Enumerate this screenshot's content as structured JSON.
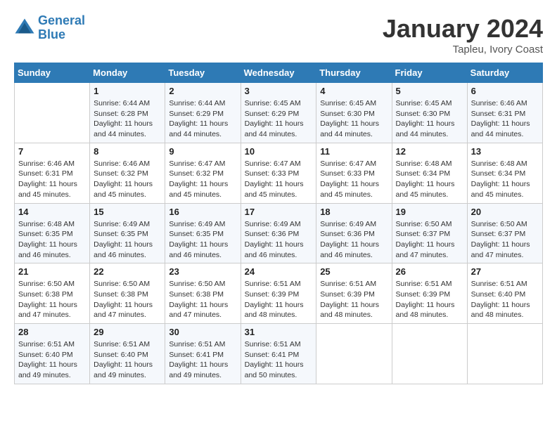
{
  "header": {
    "logo_line1": "General",
    "logo_line2": "Blue",
    "month": "January 2024",
    "location": "Tapleu, Ivory Coast"
  },
  "days_of_week": [
    "Sunday",
    "Monday",
    "Tuesday",
    "Wednesday",
    "Thursday",
    "Friday",
    "Saturday"
  ],
  "weeks": [
    [
      {
        "day": "",
        "info": ""
      },
      {
        "day": "1",
        "info": "Sunrise: 6:44 AM\nSunset: 6:28 PM\nDaylight: 11 hours and 44 minutes."
      },
      {
        "day": "2",
        "info": "Sunrise: 6:44 AM\nSunset: 6:29 PM\nDaylight: 11 hours and 44 minutes."
      },
      {
        "day": "3",
        "info": "Sunrise: 6:45 AM\nSunset: 6:29 PM\nDaylight: 11 hours and 44 minutes."
      },
      {
        "day": "4",
        "info": "Sunrise: 6:45 AM\nSunset: 6:30 PM\nDaylight: 11 hours and 44 minutes."
      },
      {
        "day": "5",
        "info": "Sunrise: 6:45 AM\nSunset: 6:30 PM\nDaylight: 11 hours and 44 minutes."
      },
      {
        "day": "6",
        "info": "Sunrise: 6:46 AM\nSunset: 6:31 PM\nDaylight: 11 hours and 44 minutes."
      }
    ],
    [
      {
        "day": "7",
        "info": "Sunrise: 6:46 AM\nSunset: 6:31 PM\nDaylight: 11 hours and 45 minutes."
      },
      {
        "day": "8",
        "info": "Sunrise: 6:46 AM\nSunset: 6:32 PM\nDaylight: 11 hours and 45 minutes."
      },
      {
        "day": "9",
        "info": "Sunrise: 6:47 AM\nSunset: 6:32 PM\nDaylight: 11 hours and 45 minutes."
      },
      {
        "day": "10",
        "info": "Sunrise: 6:47 AM\nSunset: 6:33 PM\nDaylight: 11 hours and 45 minutes."
      },
      {
        "day": "11",
        "info": "Sunrise: 6:47 AM\nSunset: 6:33 PM\nDaylight: 11 hours and 45 minutes."
      },
      {
        "day": "12",
        "info": "Sunrise: 6:48 AM\nSunset: 6:34 PM\nDaylight: 11 hours and 45 minutes."
      },
      {
        "day": "13",
        "info": "Sunrise: 6:48 AM\nSunset: 6:34 PM\nDaylight: 11 hours and 45 minutes."
      }
    ],
    [
      {
        "day": "14",
        "info": "Sunrise: 6:48 AM\nSunset: 6:35 PM\nDaylight: 11 hours and 46 minutes."
      },
      {
        "day": "15",
        "info": "Sunrise: 6:49 AM\nSunset: 6:35 PM\nDaylight: 11 hours and 46 minutes."
      },
      {
        "day": "16",
        "info": "Sunrise: 6:49 AM\nSunset: 6:35 PM\nDaylight: 11 hours and 46 minutes."
      },
      {
        "day": "17",
        "info": "Sunrise: 6:49 AM\nSunset: 6:36 PM\nDaylight: 11 hours and 46 minutes."
      },
      {
        "day": "18",
        "info": "Sunrise: 6:49 AM\nSunset: 6:36 PM\nDaylight: 11 hours and 46 minutes."
      },
      {
        "day": "19",
        "info": "Sunrise: 6:50 AM\nSunset: 6:37 PM\nDaylight: 11 hours and 47 minutes."
      },
      {
        "day": "20",
        "info": "Sunrise: 6:50 AM\nSunset: 6:37 PM\nDaylight: 11 hours and 47 minutes."
      }
    ],
    [
      {
        "day": "21",
        "info": "Sunrise: 6:50 AM\nSunset: 6:38 PM\nDaylight: 11 hours and 47 minutes."
      },
      {
        "day": "22",
        "info": "Sunrise: 6:50 AM\nSunset: 6:38 PM\nDaylight: 11 hours and 47 minutes."
      },
      {
        "day": "23",
        "info": "Sunrise: 6:50 AM\nSunset: 6:38 PM\nDaylight: 11 hours and 47 minutes."
      },
      {
        "day": "24",
        "info": "Sunrise: 6:51 AM\nSunset: 6:39 PM\nDaylight: 11 hours and 48 minutes."
      },
      {
        "day": "25",
        "info": "Sunrise: 6:51 AM\nSunset: 6:39 PM\nDaylight: 11 hours and 48 minutes."
      },
      {
        "day": "26",
        "info": "Sunrise: 6:51 AM\nSunset: 6:39 PM\nDaylight: 11 hours and 48 minutes."
      },
      {
        "day": "27",
        "info": "Sunrise: 6:51 AM\nSunset: 6:40 PM\nDaylight: 11 hours and 48 minutes."
      }
    ],
    [
      {
        "day": "28",
        "info": "Sunrise: 6:51 AM\nSunset: 6:40 PM\nDaylight: 11 hours and 49 minutes."
      },
      {
        "day": "29",
        "info": "Sunrise: 6:51 AM\nSunset: 6:40 PM\nDaylight: 11 hours and 49 minutes."
      },
      {
        "day": "30",
        "info": "Sunrise: 6:51 AM\nSunset: 6:41 PM\nDaylight: 11 hours and 49 minutes."
      },
      {
        "day": "31",
        "info": "Sunrise: 6:51 AM\nSunset: 6:41 PM\nDaylight: 11 hours and 50 minutes."
      },
      {
        "day": "",
        "info": ""
      },
      {
        "day": "",
        "info": ""
      },
      {
        "day": "",
        "info": ""
      }
    ]
  ]
}
